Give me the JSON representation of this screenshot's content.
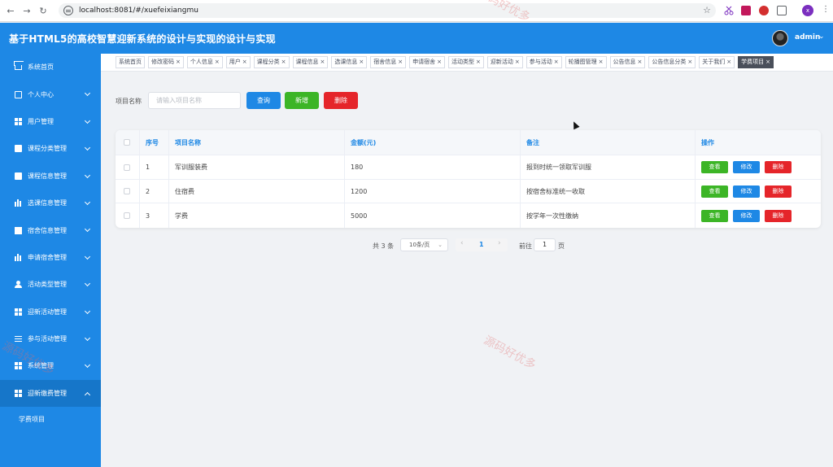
{
  "browser": {
    "url": "localhost:8081/#/xuefeixiangmu"
  },
  "header": {
    "title": "基于HTML5的高校智慧迎新系统的设计与实现的设计与实现",
    "user": "admin"
  },
  "sidebar": {
    "items": [
      {
        "label": "系统首页",
        "icon": "home-icon",
        "expandable": false
      },
      {
        "label": "个人中心",
        "icon": "card-icon",
        "expandable": true
      },
      {
        "label": "用户管理",
        "icon": "grid-icon",
        "expandable": true
      },
      {
        "label": "课程分类管理",
        "icon": "clipboard-icon",
        "expandable": true
      },
      {
        "label": "课程信息管理",
        "icon": "briefcase-icon",
        "expandable": true
      },
      {
        "label": "选课信息管理",
        "icon": "bar-chart-icon",
        "expandable": true
      },
      {
        "label": "宿舍信息管理",
        "icon": "checklist-icon",
        "expandable": true
      },
      {
        "label": "申请宿舍管理",
        "icon": "bar-chart-icon",
        "expandable": true
      },
      {
        "label": "活动类型管理",
        "icon": "user-icon",
        "expandable": true
      },
      {
        "label": "迎新活动管理",
        "icon": "grid-icon",
        "expandable": true
      },
      {
        "label": "参与活动管理",
        "icon": "list-icon",
        "expandable": true
      },
      {
        "label": "系统管理",
        "icon": "grid-icon",
        "expandable": true
      },
      {
        "label": "迎新缴费管理",
        "icon": "grid-icon",
        "expandable": true,
        "active": true
      }
    ],
    "subitem": "学费项目"
  },
  "tabs": [
    {
      "label": "系统首页",
      "closable": false
    },
    {
      "label": "修改密码",
      "closable": true
    },
    {
      "label": "个人信息",
      "closable": true
    },
    {
      "label": "用户",
      "closable": true
    },
    {
      "label": "课程分类",
      "closable": true
    },
    {
      "label": "课程信息",
      "closable": true
    },
    {
      "label": "选课信息",
      "closable": true
    },
    {
      "label": "宿舍信息",
      "closable": true
    },
    {
      "label": "申请宿舍",
      "closable": true
    },
    {
      "label": "活动类型",
      "closable": true
    },
    {
      "label": "迎新活动",
      "closable": true
    },
    {
      "label": "参与活动",
      "closable": true
    },
    {
      "label": "轮播图管理",
      "closable": true
    },
    {
      "label": "公告信息",
      "closable": true
    },
    {
      "label": "公告信息分类",
      "closable": true
    },
    {
      "label": "关于我们",
      "closable": true
    },
    {
      "label": "学费项目",
      "closable": true,
      "active": true
    }
  ],
  "search": {
    "label": "项目名称",
    "placeholder": "请输入项目名称",
    "query_btn": "查询",
    "add_btn": "新增",
    "delete_btn": "删除"
  },
  "table": {
    "headers": [
      "序号",
      "项目名称",
      "金额(元)",
      "备注",
      "操作"
    ],
    "rows": [
      {
        "index": "1",
        "name": "军训服装费",
        "amount": "180",
        "note": "报到时统一领取军训服"
      },
      {
        "index": "2",
        "name": "住宿费",
        "amount": "1200",
        "note": "按宿舍标准统一收取"
      },
      {
        "index": "3",
        "name": "学费",
        "amount": "5000",
        "note": "按学年一次性缴纳"
      }
    ],
    "actions": {
      "view": "查看",
      "edit": "修改",
      "delete": "删除"
    }
  },
  "pagination": {
    "total": "共 3 条",
    "page_size": "10条/页",
    "current": "1",
    "goto_label": "前往",
    "goto_value": "1",
    "page_suffix": "页"
  },
  "watermark": "源码好优多",
  "colors": {
    "primary": "#1e88e5",
    "success": "#3cb526",
    "danger": "#e5252a",
    "active_tab": "#4a4f5a"
  }
}
